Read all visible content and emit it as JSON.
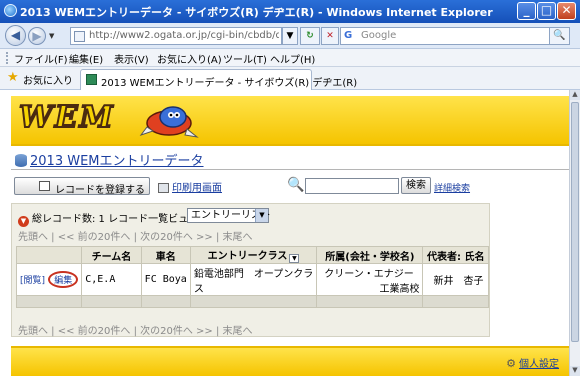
{
  "window": {
    "title": "2013 WEMエントリーデータ - サイボウズ(R) デヂエ(R) - Windows Internet Explorer",
    "minimize": "_",
    "maximize": "□",
    "close": "✕"
  },
  "nav": {
    "back": "◀",
    "forward": "▶",
    "history_drop": "▼",
    "url": "http://www2.ogata.or.jp/cgi-bin/cbdb/db.cgi?p",
    "address_drop": "▼",
    "refresh": "↻",
    "stop": "✕",
    "search_placeholder": "Google",
    "search_go": "🔍"
  },
  "menu": [
    "ファイル(F)",
    "編集(E)",
    "表示(V)",
    "お気に入り(A)",
    "ツール(T)",
    "ヘルプ(H)"
  ],
  "favorites": {
    "label": "お気に入り",
    "tab_title": "2013 WEMエントリーデータ - サイボウズ(R) デヂエ(R)"
  },
  "page": {
    "logo": "WEM",
    "db_title": "2013 WEMエントリーデータ",
    "register_button": "レコードを登録する",
    "print_link": "印刷用画面",
    "search_button": "検索",
    "advanced_search": "詳細検索",
    "record_count_label": "総レコード数: 1",
    "view_label": "レコード一覧ビュー",
    "view_selected": "エントリーリスト",
    "pager_top": "先頭へ | << 前の20件へ | 次の20件へ >> | 末尾へ",
    "pager_bottom": "先頭へ | << 前の20件へ | 次の20件へ >> | 末尾へ",
    "settings_link": "個人設定"
  },
  "table": {
    "headers": [
      "",
      "チーム名",
      "車名",
      "エントリークラス",
      "所属(会社・学校名)",
      "代表者: 氏名"
    ],
    "rows": [
      {
        "detail": "[閲覧]",
        "edit": "編集",
        "team": "C,E.A",
        "car": "FC Boya",
        "class_line1": "鉛電池部門　オープンクラ",
        "class_line2": "ス",
        "affil_line1": "クリーン・エナジー",
        "affil_line2": "工業高校",
        "rep": "新井　杏子"
      }
    ]
  },
  "colors": {
    "banner_yellow": "#f5c400",
    "link_blue": "#1a3ea0",
    "edit_circle": "#c83220"
  }
}
